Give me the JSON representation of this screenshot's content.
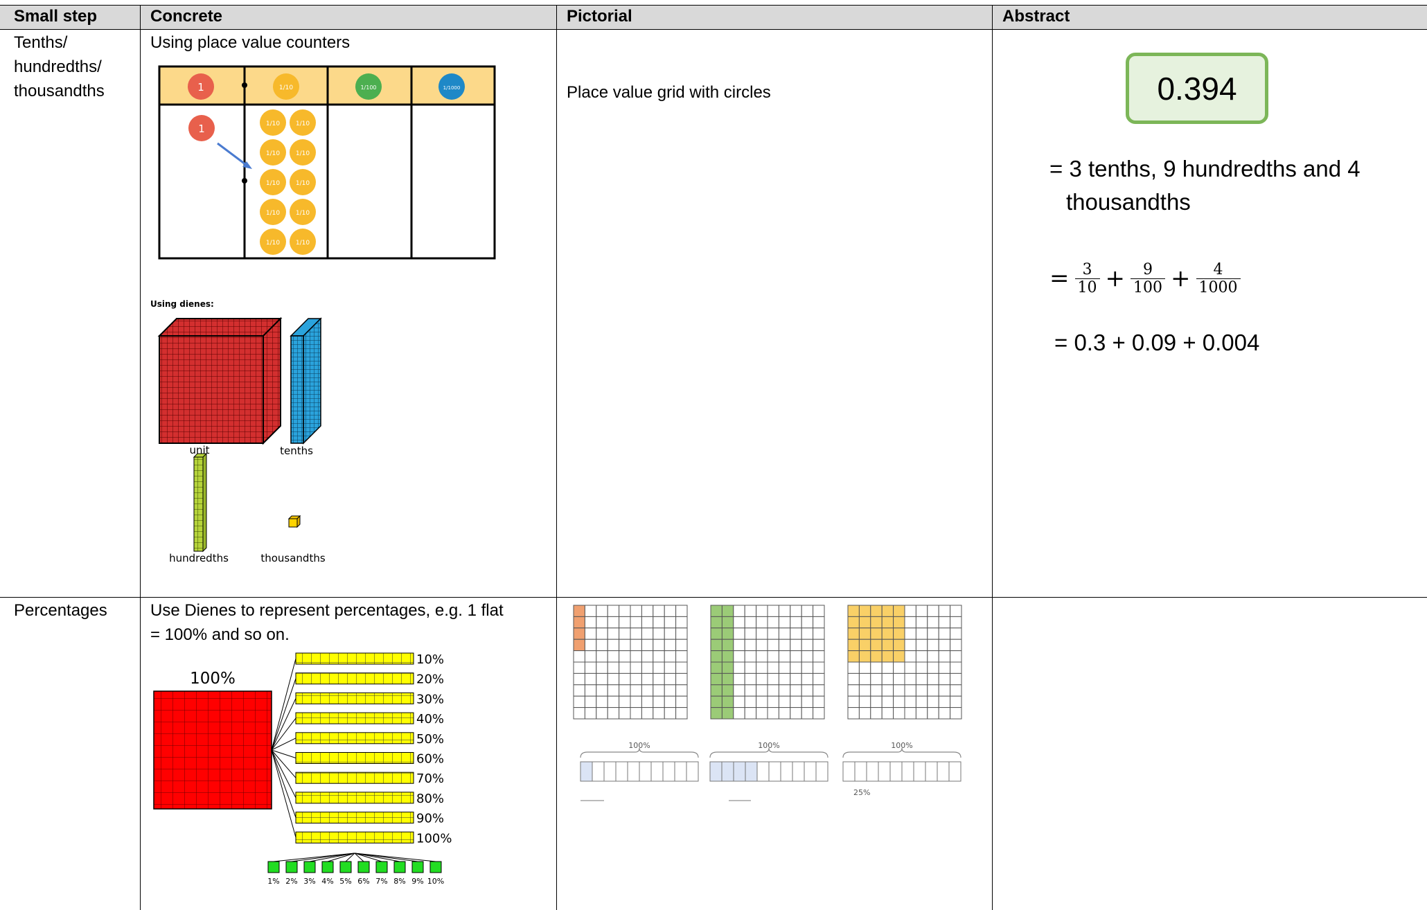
{
  "table": {
    "headers": [
      "Small step",
      "Concrete",
      "Pictorial",
      "Abstract"
    ],
    "rows": [
      {
        "small_step_lines": [
          "Tenths/",
          "hundredths/",
          "thousandths"
        ],
        "concrete": {
          "caption": "Using place value counters",
          "counter_labels": [
            "1",
            "1/10",
            "1/100",
            "1/1000"
          ],
          "dienes_title": "Using dienes:",
          "dienes_labels": [
            "unit",
            "tenths",
            "hundredths",
            "thousandths"
          ]
        },
        "pictorial": "Place value grid with circles",
        "abstract": {
          "number": "0.394",
          "line1": "= 3 tenths, 9 hundredths and 4",
          "line2": "thousandths",
          "eq_sign": "=",
          "plus": "+",
          "fractions": [
            {
              "num": "3",
              "den": "10"
            },
            {
              "num": "9",
              "den": "100"
            },
            {
              "num": "4",
              "den": "1000"
            }
          ],
          "decimal_sum": "= 0.3 + 0.09 + 0.004"
        }
      },
      {
        "small_step": "Percentages",
        "concrete": {
          "caption_line1": "Use Dienes to represent percentages, e.g. 1 flat",
          "caption_line2": "= 100% and so on.",
          "flat_label": "100%",
          "rod_labels": [
            "10%",
            "20%",
            "30%",
            "40%",
            "50%",
            "60%",
            "70%",
            "80%",
            "90%",
            "100%"
          ],
          "cube_labels": [
            "1%",
            "2%",
            "3%",
            "4%",
            "5%",
            "6%",
            "7%",
            "8%",
            "9%",
            "10%"
          ]
        },
        "pictorial": {
          "grid_shaded_fractions": [
            0.04,
            0.2,
            0.25
          ],
          "bar_labels": [
            "100%",
            "100%",
            "100%"
          ],
          "bar_shaded_fractions": [
            0.1,
            0.4,
            0
          ],
          "bar_below_label": "25%"
        },
        "abstract": ""
      }
    ]
  },
  "colors": {
    "header_bg": "#d9d9d9",
    "counter_row_bg": "#fcd98a",
    "counter_red": "#e8604c",
    "counter_yellow": "#f7b92b",
    "counter_green": "#4caf50",
    "counter_blue": "#1e88c7",
    "dienes_red": "#d32f2f",
    "dienes_blue": "#2aa3dc",
    "dienes_green": "#b6d43a",
    "box_border": "#7cb658",
    "box_fill": "#e6f2de",
    "flat_red": "#ff0000",
    "rod_yellow": "#ffff00",
    "cube_green": "#22dd22",
    "grid_orange": "#f0a070",
    "grid_green": "#9bcb77",
    "grid_yellow": "#f9d067",
    "bar_blue": "#dbe4f5"
  }
}
